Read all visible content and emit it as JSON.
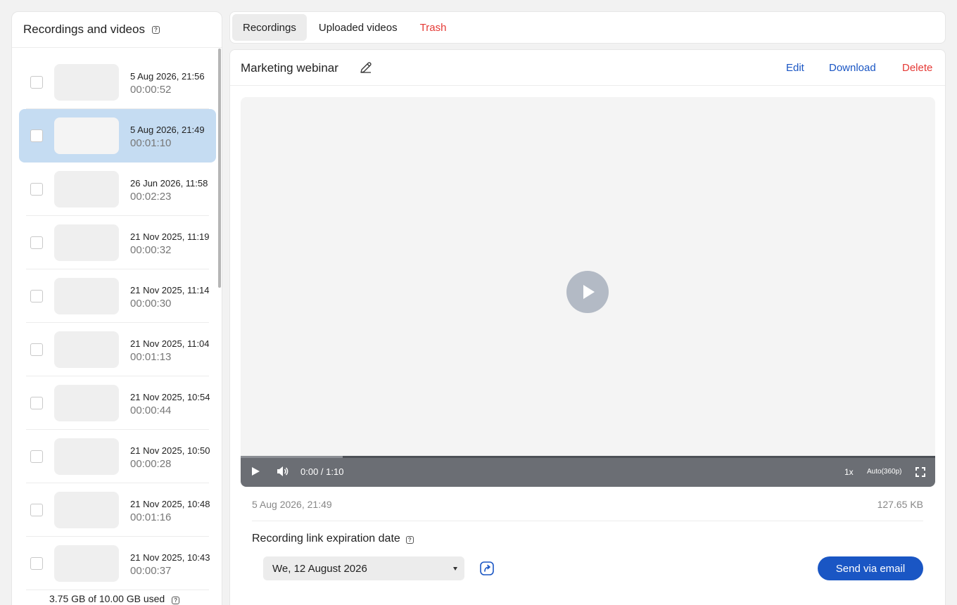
{
  "sidebar": {
    "title": "Recordings and videos",
    "help_glyph": "?",
    "items": [
      {
        "date": "5 Aug 2026, 21:56",
        "duration": "00:00:52",
        "selected": false
      },
      {
        "date": "5 Aug 2026, 21:49",
        "duration": "00:01:10",
        "selected": true
      },
      {
        "date": "26 Jun 2026, 11:58",
        "duration": "00:02:23",
        "selected": false
      },
      {
        "date": "21 Nov 2025, 11:19",
        "duration": "00:00:32",
        "selected": false
      },
      {
        "date": "21 Nov 2025, 11:14",
        "duration": "00:00:30",
        "selected": false
      },
      {
        "date": "21 Nov 2025, 11:04",
        "duration": "00:01:13",
        "selected": false
      },
      {
        "date": "21 Nov 2025, 10:54",
        "duration": "00:00:44",
        "selected": false
      },
      {
        "date": "21 Nov 2025, 10:50",
        "duration": "00:00:28",
        "selected": false
      },
      {
        "date": "21 Nov 2025, 10:48",
        "duration": "00:01:16",
        "selected": false
      },
      {
        "date": "21 Nov 2025, 10:43",
        "duration": "00:00:37",
        "selected": false
      }
    ],
    "storage": "3.75 GB of 10.00 GB used"
  },
  "tabs": [
    {
      "label": "Recordings",
      "active": true
    },
    {
      "label": "Uploaded videos",
      "active": false
    },
    {
      "label": "Trash",
      "active": false
    }
  ],
  "recording": {
    "title": "Marketing webinar",
    "actions": {
      "edit": "Edit",
      "download": "Download",
      "delete": "Delete"
    },
    "player": {
      "time": "0:00  /  1:10",
      "speed": "1x",
      "quality": "Auto(360p)",
      "buffered_fraction": 0.147
    },
    "date": "5 Aug 2026, 21:49",
    "size": "127.65 KB",
    "expiration_label": "Recording link expiration date",
    "expiration_date": "We, 12 August 2026",
    "send_label": "Send via email"
  },
  "colors": {
    "accent": "#1a56c4",
    "danger": "#e53935",
    "selected": "#c5dcf2"
  },
  "icons": [
    "help-icon",
    "pencil-icon",
    "play-icon",
    "volume-icon",
    "fullscreen-icon",
    "share-link-icon",
    "caret-down-icon"
  ]
}
